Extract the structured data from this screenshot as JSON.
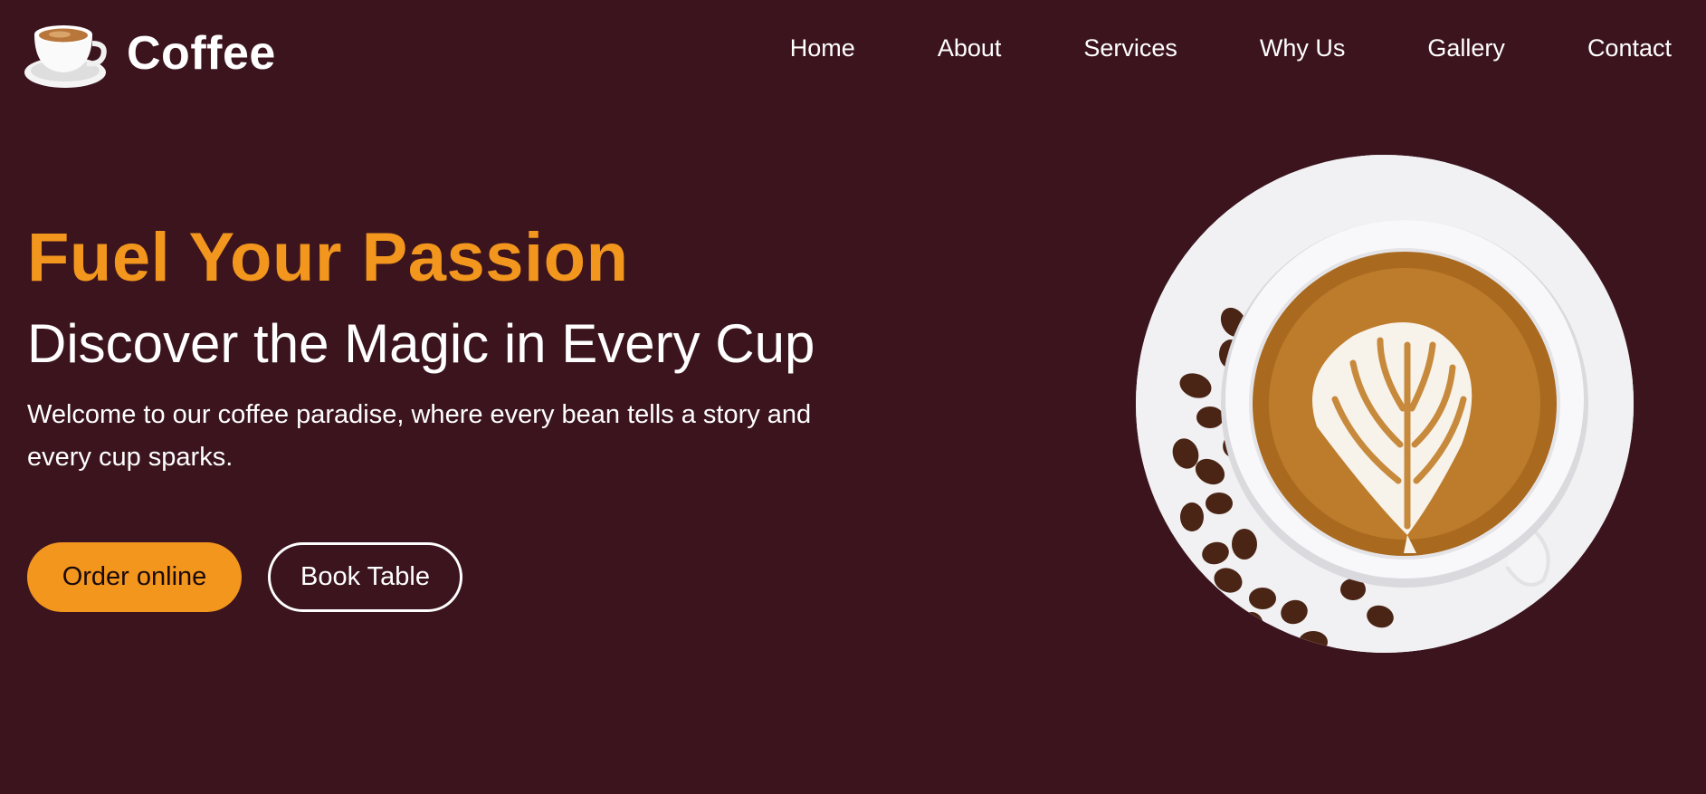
{
  "brand": {
    "name": "Coffee",
    "logo_icon": "coffee-cup-icon"
  },
  "nav": {
    "items": [
      {
        "label": "Home"
      },
      {
        "label": "About"
      },
      {
        "label": "Services"
      },
      {
        "label": "Why Us"
      },
      {
        "label": "Gallery"
      },
      {
        "label": "Contact"
      }
    ]
  },
  "hero": {
    "title": "Fuel Your Passion",
    "subtitle": "Discover the Magic in Every Cup",
    "text": "Welcome to our coffee paradise, where every bean tells a story and every cup sparks.",
    "primary_button": "Order online",
    "secondary_button": "Book Table",
    "image_icon": "latte-cup-image"
  },
  "colors": {
    "background": "#3b141e",
    "accent": "#f2961d",
    "text": "#ffffff"
  }
}
